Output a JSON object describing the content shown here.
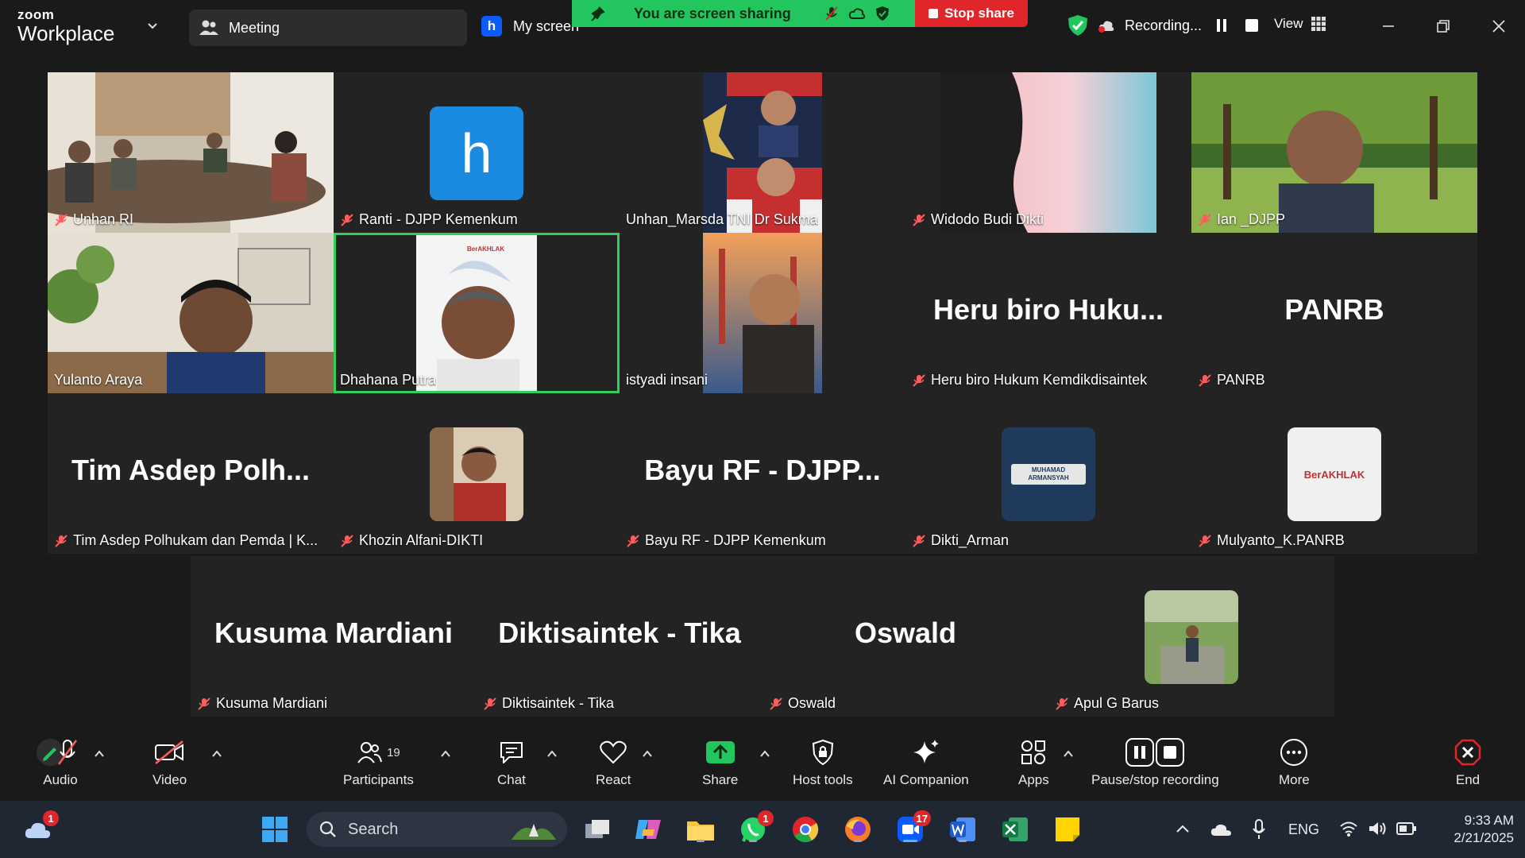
{
  "titlebar": {
    "brand_small": "zoom",
    "brand_large": "Workplace",
    "meeting_label": "Meeting",
    "my_screen_badge": "h",
    "my_screen_label": "My screen",
    "sharing_text": "You are screen sharing",
    "stop_share_label": "Stop share",
    "recording_label": "Recording...",
    "view_label": "View"
  },
  "tiles": [
    {
      "name": "Unhan RI"
    },
    {
      "name": "Ranti - DJPP Kemenkum",
      "avatar_letter": "h"
    },
    {
      "name": "Unhan_Marsda TNI Dr Sukma"
    },
    {
      "name": "Widodo Budi Dikti"
    },
    {
      "name": "Ian _DJPP"
    },
    {
      "name": "Yulanto Araya"
    },
    {
      "name": "Dhahana Putra",
      "poster_text": "BerAKHLAK"
    },
    {
      "name": "istyadi insani"
    },
    {
      "name": "Heru biro Hukum Kemdikdisaintek",
      "display": "Heru biro Huku..."
    },
    {
      "name": "PANRB",
      "display": "PANRB"
    },
    {
      "name": "Tim Asdep Polhukam dan Pemda | K...",
      "display": "Tim Asdep Polh..."
    },
    {
      "name": "Khozin Alfani-DIKTI"
    },
    {
      "name": "Bayu RF - DJPP Kemenkum",
      "display": "Bayu RF - DJPP..."
    },
    {
      "name": "Dikti_Arman",
      "avatar_text": "MUHAMAD ARMANSYAH"
    },
    {
      "name": "Mulyanto_K.PANRB",
      "avatar_text": "BerAKHLAK"
    },
    {
      "name": "Kusuma Mardiani",
      "display": "Kusuma Mardiani"
    },
    {
      "name": "Diktisaintek - Tika",
      "display": "Diktisaintek - Tika"
    },
    {
      "name": "Oswald",
      "display": "Oswald"
    },
    {
      "name": "Apul G Barus"
    }
  ],
  "controls": {
    "audio": "Audio",
    "video": "Video",
    "participants": "Participants",
    "participants_count": "19",
    "chat": "Chat",
    "react": "React",
    "share": "Share",
    "host_tools": "Host tools",
    "ai_companion": "AI Companion",
    "apps": "Apps",
    "pause_stop_recording": "Pause/stop recording",
    "more": "More",
    "end": "End"
  },
  "taskbar": {
    "search_placeholder": "Search",
    "weather_badge": "1",
    "whatsapp_badge": "1",
    "zoom_badge": "17",
    "language": "ENG",
    "time": "9:33 AM",
    "date": "2/21/2025"
  },
  "colors": {
    "accent_green": "#22c55e",
    "stop_red": "#e0262b",
    "active_speaker": "#2fd05c",
    "zoom_blue": "#0b5cff"
  }
}
